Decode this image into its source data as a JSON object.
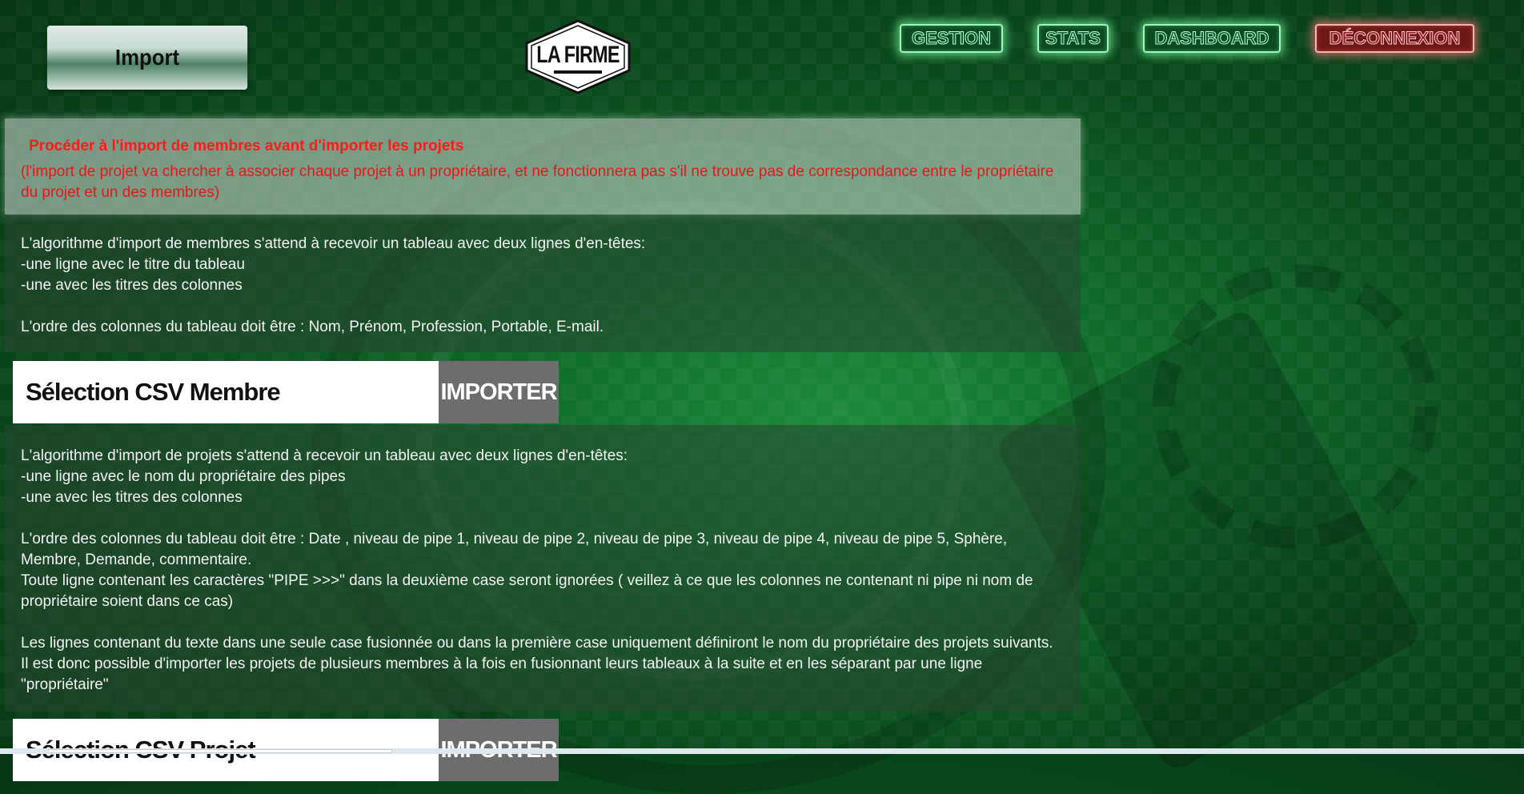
{
  "header": {
    "page_button": "Import",
    "logo_text": "LA FIRME",
    "nav": [
      "GESTION",
      "STATS",
      "DASHBOARD",
      "DÉCONNEXION"
    ]
  },
  "warning": {
    "title": "Procéder à l'import de membres avant d'importer les projets",
    "text": "(l'import de projet va chercher à associer chaque projet à un propriétaire, et ne fonctionnera pas s'il ne trouve pas de correspondance entre le propriétaire du projet et un des membres)"
  },
  "members_info": {
    "lines": [
      "L'algorithme d'import de membres s'attend à recevoir un tableau avec deux lignes d'en-têtes:",
      "-une ligne avec le titre du tableau",
      "-une avec les titres des colonnes",
      "L'ordre des colonnes du tableau doit être : Nom, Prénom, Profession, Portable, E-mail."
    ]
  },
  "csv_members": {
    "label": "Sélection CSV Membre",
    "button": "IMPORTER"
  },
  "projects_info": {
    "lines": [
      "L'algorithme d'import de projets s'attend à recevoir un tableau avec deux lignes d'en-têtes:",
      "-une ligne avec le nom du propriétaire des pipes",
      "-une avec les titres des colonnes",
      "L'ordre des colonnes du tableau doit être : Date , niveau de pipe 1, niveau de pipe 2, niveau de pipe 3, niveau de pipe 4, niveau de pipe 5, Sphère, Membre, Demande, commentaire.",
      "Toute ligne contenant les caractères \"PIPE >>>\" dans la deuxième case seront ignorées ( veillez à ce que les colonnes ne contenant ni pipe ni nom de propriétaire soient dans ce cas)",
      "Les lignes contenant du texte dans une seule case fusionnée ou dans la première case uniquement définiront le nom du propriétaire des projets suivants.",
      "Il est donc possible d'importer les projets de plusieurs membres à la fois en fusionnant leurs tableaux à la suite et en les séparant par une ligne \"propriétaire\""
    ]
  },
  "csv_projects": {
    "label": "Sélection CSV Projet",
    "button": "IMPORTER"
  }
}
